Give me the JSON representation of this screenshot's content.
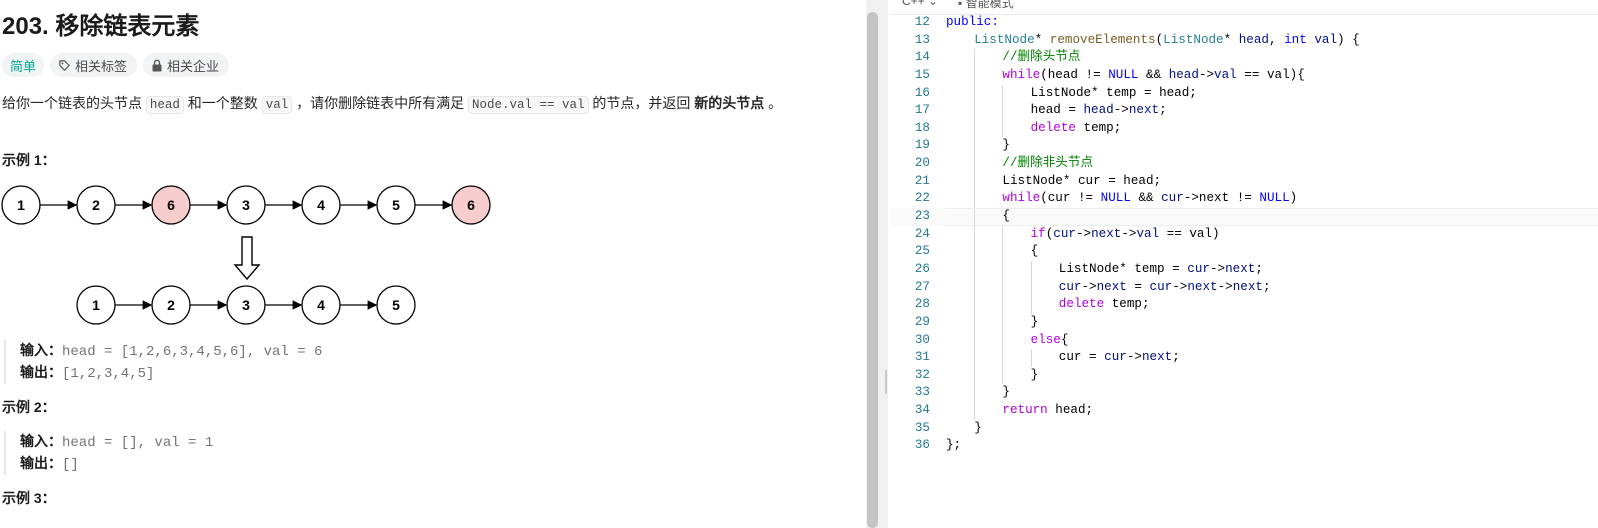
{
  "problem": {
    "title": "203. 移除链表元素",
    "difficulty": "简单",
    "tag_topics": "相关标签",
    "tag_companies": "相关企业",
    "desc_1": "给你一个链表的头节点 ",
    "desc_code_1": "head",
    "desc_2": " 和一个整数 ",
    "desc_code_2": "val",
    "desc_3": " ，请你删除链表中所有满足 ",
    "desc_code_3": "Node.val == val",
    "desc_4": " 的节点，并返回 ",
    "desc_bold": "新的头节点",
    "desc_5": " 。"
  },
  "examples": [
    {
      "title": "示例 1：",
      "input_label": "输入：",
      "input": "head = [1,2,6,3,4,5,6], val = 6",
      "output_label": "输出：",
      "output": "[1,2,3,4,5]"
    },
    {
      "title": "示例 2：",
      "input_label": "输入：",
      "input": "head = [], val = 1",
      "output_label": "输出：",
      "output": "[]"
    },
    {
      "title": "示例 3："
    }
  ],
  "diagram": {
    "top_nodes": [
      "1",
      "2",
      "6",
      "3",
      "4",
      "5",
      "6"
    ],
    "top_removed": [
      false,
      false,
      true,
      false,
      false,
      false,
      true
    ],
    "bottom_nodes": [
      "1",
      "2",
      "3",
      "4",
      "5"
    ],
    "removed_fill": "#f6cccc"
  },
  "editor": {
    "language": "C++",
    "mode": "智能模式",
    "active_line": 23,
    "lines": [
      {
        "n": "12",
        "indent": 0,
        "tokens": [
          [
            "kt",
            "public:"
          ]
        ]
      },
      {
        "n": "13",
        "indent": 1,
        "tokens": [
          [
            "ty",
            "ListNode"
          ],
          [
            "",
            "* "
          ],
          [
            "fn",
            "removeElements"
          ],
          [
            "",
            "("
          ],
          [
            "ty",
            "ListNode"
          ],
          [
            "",
            "* "
          ],
          [
            "va",
            "head"
          ],
          [
            "",
            ", "
          ],
          [
            "kt",
            "int"
          ],
          [
            "",
            ""
          ],
          [
            "va",
            " val"
          ],
          [
            "",
            ") {"
          ]
        ]
      },
      {
        "n": "14",
        "indent": 2,
        "tokens": [
          [
            "cm",
            "//删除头节点"
          ]
        ]
      },
      {
        "n": "15",
        "indent": 2,
        "tokens": [
          [
            "kw",
            "while"
          ],
          [
            "",
            "(head != "
          ],
          [
            "nu",
            "NULL"
          ],
          [
            "",
            " && "
          ],
          [
            "va",
            "head"
          ],
          [
            "",
            "->"
          ],
          [
            "va",
            "val"
          ],
          [
            "",
            " == val){"
          ]
        ]
      },
      {
        "n": "16",
        "indent": 3,
        "tokens": [
          [
            "",
            "ListNode* temp = head;"
          ]
        ]
      },
      {
        "n": "17",
        "indent": 3,
        "tokens": [
          [
            "",
            "head = "
          ],
          [
            "va",
            "head"
          ],
          [
            "",
            "->"
          ],
          [
            "va",
            "next"
          ],
          [
            "",
            ";"
          ]
        ]
      },
      {
        "n": "18",
        "indent": 3,
        "tokens": [
          [
            "kw",
            "delete"
          ],
          [
            "",
            " temp;"
          ]
        ]
      },
      {
        "n": "19",
        "indent": 2,
        "tokens": [
          [
            "",
            "}"
          ]
        ]
      },
      {
        "n": "20",
        "indent": 2,
        "tokens": [
          [
            "cm",
            "//删除非头节点"
          ]
        ]
      },
      {
        "n": "21",
        "indent": 2,
        "tokens": [
          [
            "",
            "ListNode* cur = head;"
          ]
        ]
      },
      {
        "n": "22",
        "indent": 2,
        "tokens": [
          [
            "kw",
            "while"
          ],
          [
            "",
            "(cur != "
          ],
          [
            "nu",
            "NULL"
          ],
          [
            "",
            " && "
          ],
          [
            "va",
            "cur"
          ],
          [
            "",
            "->next != "
          ],
          [
            "nu",
            "NULL"
          ],
          [
            "",
            ")"
          ]
        ]
      },
      {
        "n": "23",
        "indent": 2,
        "tokens": [
          [
            "",
            "{"
          ]
        ]
      },
      {
        "n": "24",
        "indent": 3,
        "tokens": [
          [
            "kw",
            "if"
          ],
          [
            "",
            "("
          ],
          [
            "va",
            "cur"
          ],
          [
            "",
            "->"
          ],
          [
            "va",
            "next"
          ],
          [
            "",
            "->"
          ],
          [
            "va",
            "val"
          ],
          [
            "",
            " == val)"
          ]
        ]
      },
      {
        "n": "25",
        "indent": 3,
        "tokens": [
          [
            "",
            "{"
          ]
        ]
      },
      {
        "n": "26",
        "indent": 4,
        "tokens": [
          [
            "",
            "ListNode* temp = "
          ],
          [
            "va",
            "cur"
          ],
          [
            "",
            "->"
          ],
          [
            "va",
            "next"
          ],
          [
            "",
            ";"
          ]
        ]
      },
      {
        "n": "27",
        "indent": 4,
        "tokens": [
          [
            "va",
            "cur"
          ],
          [
            "",
            "->"
          ],
          [
            "va",
            "next"
          ],
          [
            "",
            " = "
          ],
          [
            "va",
            "cur"
          ],
          [
            "",
            "->"
          ],
          [
            "va",
            "next"
          ],
          [
            "",
            "->"
          ],
          [
            "va",
            "next"
          ],
          [
            "",
            ";"
          ]
        ]
      },
      {
        "n": "28",
        "indent": 4,
        "tokens": [
          [
            "kw",
            "delete"
          ],
          [
            "",
            " temp;"
          ]
        ]
      },
      {
        "n": "29",
        "indent": 3,
        "tokens": [
          [
            "",
            "}"
          ]
        ]
      },
      {
        "n": "30",
        "indent": 3,
        "tokens": [
          [
            "kw",
            "else"
          ],
          [
            "",
            "{"
          ]
        ]
      },
      {
        "n": "31",
        "indent": 4,
        "tokens": [
          [
            "",
            "cur = "
          ],
          [
            "va",
            "cur"
          ],
          [
            "",
            "->"
          ],
          [
            "va",
            "next"
          ],
          [
            "",
            ";"
          ]
        ]
      },
      {
        "n": "32",
        "indent": 3,
        "tokens": [
          [
            "",
            "}"
          ]
        ]
      },
      {
        "n": "33",
        "indent": 2,
        "tokens": [
          [
            "",
            "}"
          ]
        ]
      },
      {
        "n": "34",
        "indent": 2,
        "tokens": [
          [
            "kw",
            "return"
          ],
          [
            "",
            " head;"
          ]
        ]
      },
      {
        "n": "35",
        "indent": 1,
        "tokens": [
          [
            "",
            "}"
          ]
        ]
      },
      {
        "n": "36",
        "indent": 0,
        "tokens": [
          [
            "",
            "};"
          ]
        ]
      }
    ]
  },
  "colors": {
    "easy": "#00a69a",
    "line_number": "#237893",
    "keyword": "#af00db",
    "comment": "#008000"
  }
}
